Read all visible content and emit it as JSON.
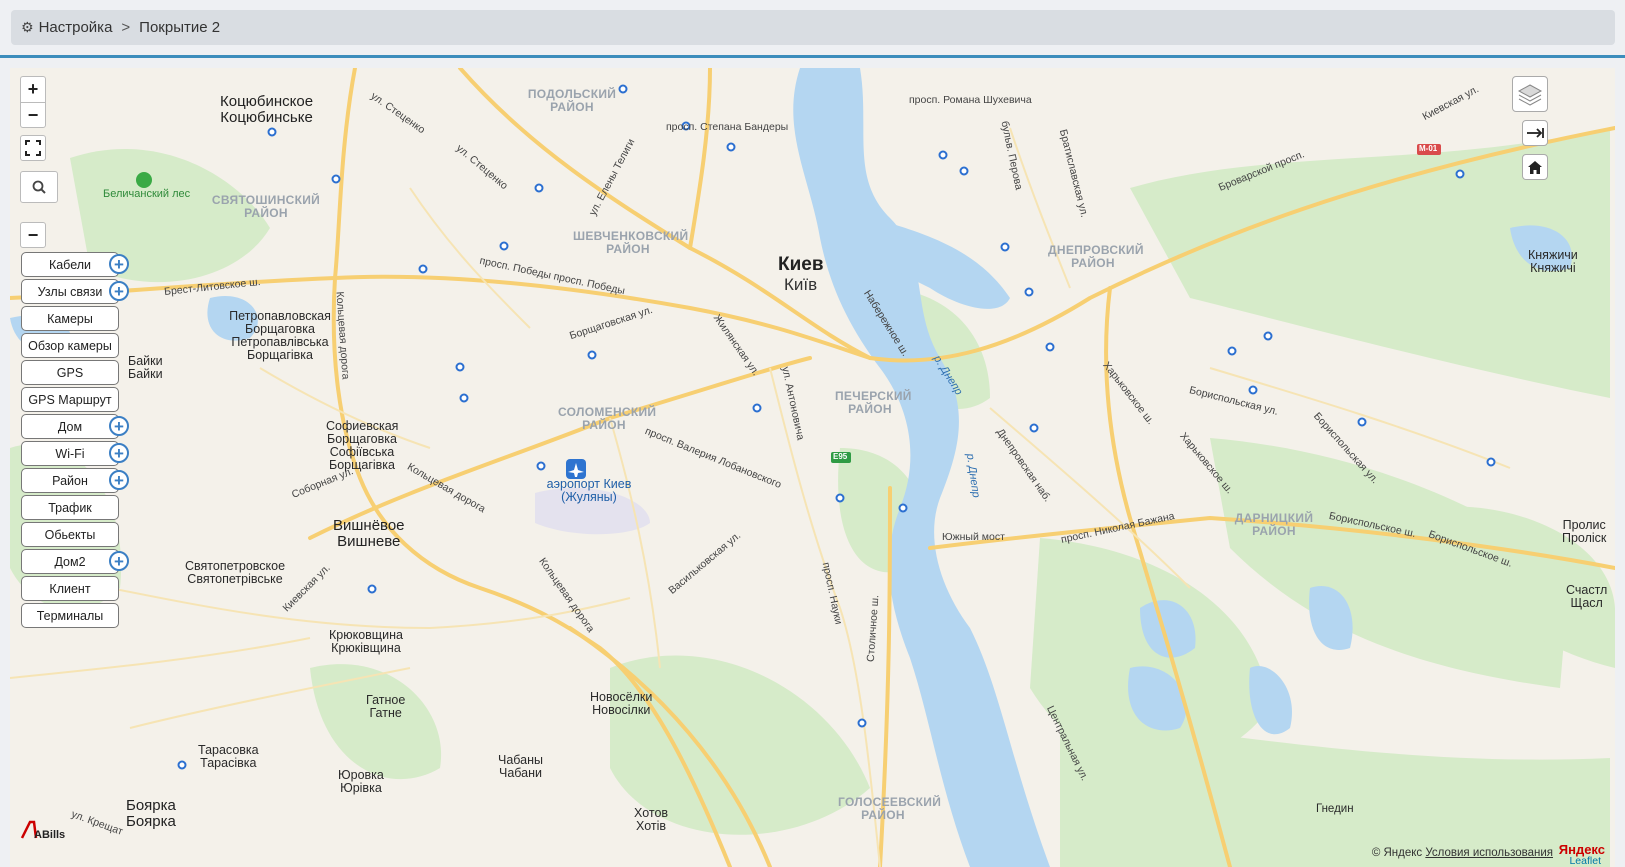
{
  "breadcrumb": {
    "root": "Настройка",
    "separator": ">",
    "current": "Покрытие 2"
  },
  "map_controls": {
    "zoom_in": "+",
    "zoom_out": "−",
    "search_zoom_out": "−"
  },
  "layers": [
    {
      "label": "Кабели",
      "expandable": true
    },
    {
      "label": "Узлы связи",
      "expandable": true
    },
    {
      "label": "Камеры",
      "expandable": false
    },
    {
      "label": "Обзор камеры",
      "expandable": false
    },
    {
      "label": "GPS",
      "expandable": false
    },
    {
      "label": "GPS Маршрут",
      "expandable": false
    },
    {
      "label": "Дом",
      "expandable": true
    },
    {
      "label": "Wi-Fi",
      "expandable": true
    },
    {
      "label": "Район",
      "expandable": true
    },
    {
      "label": "Трафик",
      "expandable": false
    },
    {
      "label": "Обьекты",
      "expandable": false
    },
    {
      "label": "Дом2",
      "expandable": true
    },
    {
      "label": "Клиент",
      "expandable": false
    },
    {
      "label": "Терминалы",
      "expandable": false
    }
  ],
  "map_labels": {
    "kyiv_ru": "Киев",
    "kyiv_ua": "Київ",
    "kotsyubinske_ru": "Коцюбинское",
    "kotsyubinske_ua": "Коцюбинське",
    "belichansky": "Беличанский лес",
    "svyatoshinsky": "СВЯТОШИНСКИЙ РАЙОН",
    "podolsky": "ПОДОЛЬСКИЙ РАЙОН",
    "shevchenkovsky": "ШЕВЧЕНКОВСКИЙ РАЙОН",
    "solomensky": "СОЛОМЕНСКИЙ РАЙОН",
    "pechersky": "ПЕЧЕРСКИЙ РАЙОН",
    "dneprovsky": "ДНЕПРОВСКИЙ РАЙОН",
    "darnitsky": "ДАРНИЦКИЙ РАЙОН",
    "goloseevsky": "ГОЛОСЕЕВСКИЙ РАЙОН",
    "petropavl_ru": "Петропавловская Борщаговка",
    "petropavl_ua": "Петропавлівська Борщагівка",
    "sofievskaya_ru": "Софиевская Борщаговка",
    "sofievskaya_ua": "Софіївська Борщагівка",
    "vishnevoe_ru": "Вишнёвое",
    "vishnevoe_ua": "Вишневе",
    "svyatopetr_ru": "Святопетровское",
    "svyatopetr_ua": "Святопетрівське",
    "kryukovschina_ru": "Крюковщина",
    "kryukovschina_ua": "Крюківщина",
    "gatnoe_ru": "Гатное",
    "gatnoe_ua": "Гатне",
    "tarasovka_ru": "Тарасовка",
    "tarasovka_ua": "Тарасівка",
    "yurovka_ru": "Юровка",
    "yurovka_ua": "Юрівка",
    "boyarka_ru": "Боярка",
    "boyarka_ua": "Боярка",
    "chabany_ru": "Чабаны",
    "chabany_ua": "Чабани",
    "novosyolki_ru": "Новосёлки",
    "novosyolki_ua": "Новосілки",
    "khotov_ru": "Хотов",
    "khotov_ua": "Хотів",
    "knyazhichi_ru": "Княжичи",
    "knyazhichi_ua": "Княжичі",
    "prolis_ru": "Пролис",
    "prolis_ua": "Проліск",
    "schastl_ru": "Счастл",
    "schastl_ua": "Щасл",
    "gnedin": "Гнедин",
    "airport": "аэропорт Киев (Жуляны)",
    "dnepr1": "р. Днепр",
    "dnepr2": "р. Днепр",
    "st_stetsenko1": "ул. Стеценко",
    "st_stetsenko2": "ул. Стеценко",
    "st_teligi": "ул. Елены Телиги",
    "st_bandery": "просп. Степана Бандеры",
    "st_shukhevycha": "просп. Романа Шухевича",
    "st_pobedy": "просп. Победы просп. Победы",
    "st_brest": "Брест-Литовское ш.",
    "st_koltsevaya1": "Кольцевая дорога",
    "st_koltsevaya2": "Кольцевая дорога",
    "st_koltsevaya3": "Кольцевая дорога",
    "st_borschag": "Борщаговская ул.",
    "st_zhilyan": "Жилянская ул.",
    "st_antonovicha": "ул. Антоновича",
    "st_lobanovskogo": "просп. Валерия Лобановского",
    "st_naberezhnoe": "Набережное ш.",
    "st_sobornaya": "Соборная ул.",
    "st_kievskaya": "Киевская ул.",
    "st_vasilkov": "Васильковская ул.",
    "st_nauki": "просп. Науки",
    "st_stolichnoe": "Столичное ш.",
    "st_yuzhny": "Южный мост",
    "st_bazhana": "просп. Николая Бажана",
    "st_dneprovsk": "Днепровская наб.",
    "st_kharkovskoe1": "Харьковское ш.",
    "st_kharkovskoe2": "Харьковское ш.",
    "st_borispol1": "Бориспольская ул.",
    "st_borispol2": "Бориспольское ш.",
    "st_borispol3": "Бориспольское ш.",
    "st_borispol4": "Бориспольская ул.",
    "st_brovary": "Броварской просп.",
    "st_bratislav": "Братиславская ул.",
    "st_perova": "бульв. Перова",
    "st_kievskaya2": "Киевская ул.",
    "st_tsentr": "Центральная ул.",
    "st_kreschat": "ул. Крещат",
    "road_e95": "E95",
    "road_m01": "M-01",
    "baykiy_ru": "Байки",
    "baykiy_ua": "Байки"
  },
  "attribution": {
    "yandex": "© Яндекс",
    "terms": "Условия использования",
    "leaflet": "Leaflet",
    "yandex_logo": "Яндекс"
  },
  "logo": "ABills",
  "colors": {
    "accent": "#3c8dbc",
    "water": "#aad3f0",
    "park": "#cfe8c4",
    "road": "#f9d27a"
  }
}
